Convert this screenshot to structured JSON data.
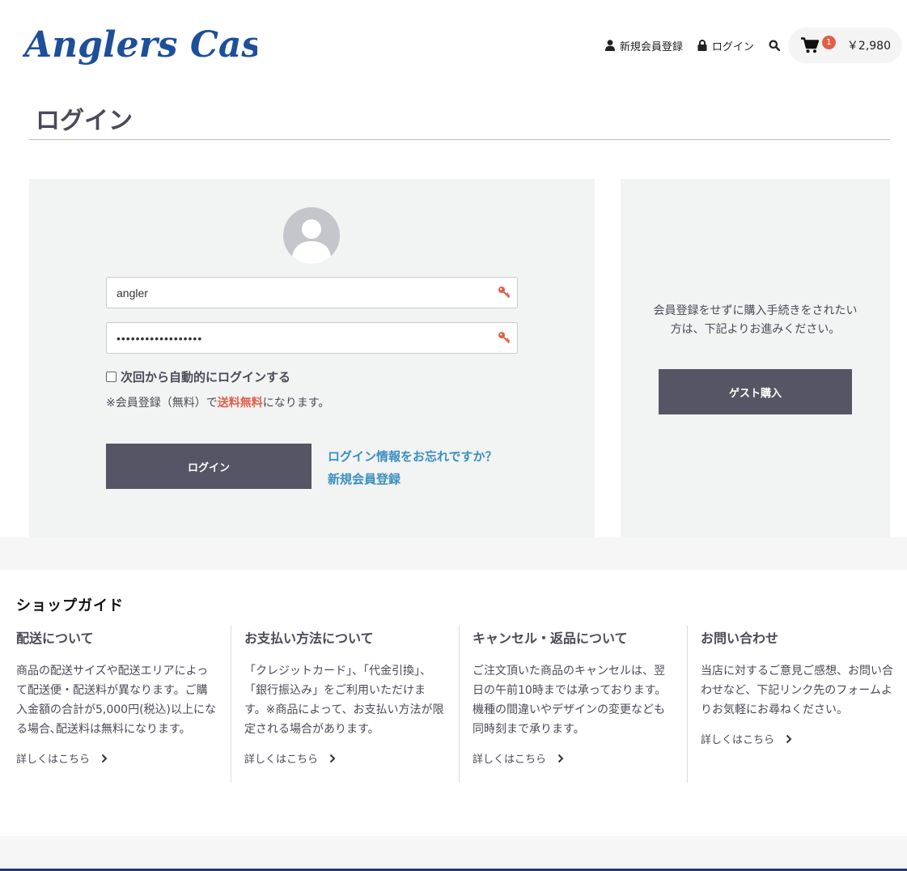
{
  "header": {
    "logo_text": "Anglers Case",
    "nav": {
      "register": "新規会員登録",
      "login": "ログイン"
    },
    "cart": {
      "count": "1",
      "total": "￥2,980"
    },
    "colors": {
      "logo": "#1d4f9a",
      "badge": "#e0604a"
    }
  },
  "page": {
    "title": "ログイン"
  },
  "login_form": {
    "username_value": "angler",
    "password_value": "••••••••••••••••••",
    "remember_label": "次回から自動的にログインする",
    "remember_checked": false,
    "note_prefix": "※会員登録（無料）で",
    "note_highlight": "送料無料",
    "note_suffix": "になります。",
    "submit_label": "ログイン",
    "forgot_link": "ログイン情報をお忘れですか？",
    "register_link": "新規会員登録"
  },
  "guest": {
    "text": "会員登録をせずに購入手続きをされたい方は、下記よりお進みください。",
    "button_label": "ゲスト購入"
  },
  "shop_guide": {
    "title": "ショップガイド",
    "more_label": "詳しくはこちら",
    "columns": [
      {
        "heading": "配送について",
        "body": "商品の配送サイズや配送エリアによって配送便・配送料が異なります。ご購入金額の合計が5,000円(税込)以上になる場合､配送料は無料になります。"
      },
      {
        "heading": "お支払い方法について",
        "body": "「クレジットカード」、「代金引換」、「銀行振込み」をご利用いただけます。※商品によって、お支払い方法が限定される場合があります。"
      },
      {
        "heading": "キャンセル・返品について",
        "body": "ご注文頂いた商品のキャンセルは、翌日の午前10時までは承っております。機種の間違いやデザインの変更なども同時刻まで承ります。"
      },
      {
        "heading": "お問い合わせ",
        "body": "当店に対するご意見ご感想、お問い合わせなど、下記リンク先のフォームよりお気軽にお尋ねください。"
      }
    ]
  }
}
